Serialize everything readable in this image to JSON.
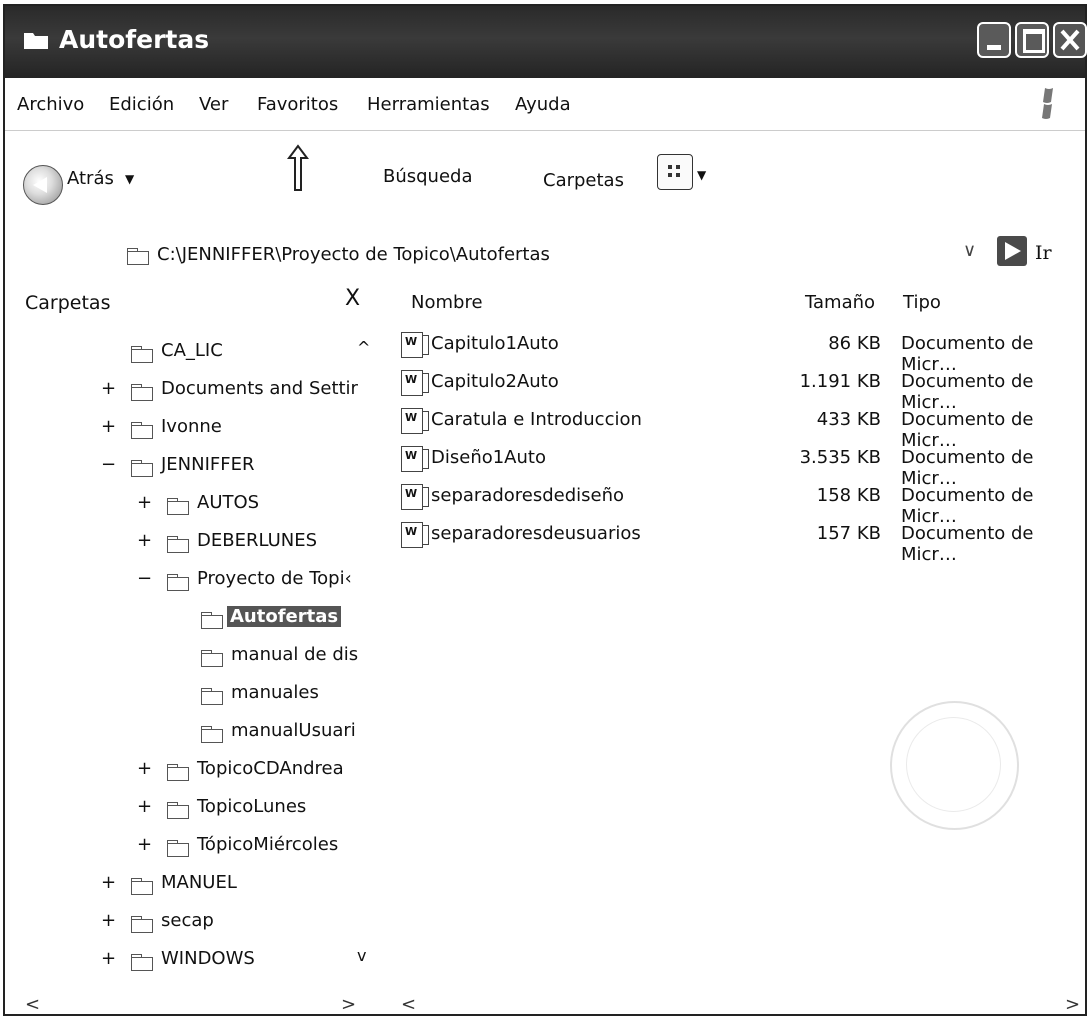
{
  "window": {
    "title": "Autofertas"
  },
  "menu": [
    "Archivo",
    "Edición",
    "Ver",
    "Favoritos",
    "Herramientas",
    "Ayuda"
  ],
  "toolbar": {
    "back_label": "Atrás",
    "search_label": "Búsqueda",
    "folders_label": "Carpetas"
  },
  "address": {
    "path": "C:\\JENNIFFER\\Proyecto de Topico\\Autofertas",
    "go_label": "Ir"
  },
  "folders_pane": {
    "title": "Carpetas",
    "close": "X",
    "tree": [
      {
        "label": "CA_LIC",
        "toggle": ""
      },
      {
        "label": "Documents and Settir",
        "toggle": "+"
      },
      {
        "label": "Ivonne",
        "toggle": "+"
      },
      {
        "label": "JENNIFFER",
        "toggle": "−"
      },
      {
        "label": "AUTOS",
        "toggle": "+"
      },
      {
        "label": "DEBERLUNES",
        "toggle": "+"
      },
      {
        "label": "Proyecto de Topi‹",
        "toggle": "−"
      },
      {
        "label": "Autofertas",
        "toggle": ""
      },
      {
        "label": "manual de dis",
        "toggle": ""
      },
      {
        "label": "manuales",
        "toggle": ""
      },
      {
        "label": "manualUsuari",
        "toggle": ""
      },
      {
        "label": "TopicoCDAndrea",
        "toggle": "+"
      },
      {
        "label": "TopicoLunes",
        "toggle": "+"
      },
      {
        "label": "TópicoMiércoles",
        "toggle": "+"
      },
      {
        "label": "MANUEL",
        "toggle": "+"
      },
      {
        "label": "secap",
        "toggle": "+"
      },
      {
        "label": "WINDOWS",
        "toggle": "+"
      }
    ]
  },
  "file_list": {
    "columns": [
      "Nombre",
      "Tamaño",
      "Tipo"
    ],
    "rows": [
      {
        "name": "Capitulo1Auto",
        "size": "86 KB",
        "type": "Documento de Micr…"
      },
      {
        "name": "Capitulo2Auto",
        "size": "1.191 KB",
        "type": "Documento de Micr…"
      },
      {
        "name": "Caratula e Introduccion",
        "size": "433 KB",
        "type": "Documento de Micr…"
      },
      {
        "name": "Diseño1Auto",
        "size": "3.535 KB",
        "type": "Documento de Micr…"
      },
      {
        "name": "separadoresdediseño",
        "size": "158 KB",
        "type": "Documento de Micr…"
      },
      {
        "name": "separadoresdeusuarios",
        "size": "157 KB",
        "type": "Documento de Micr…"
      }
    ]
  }
}
